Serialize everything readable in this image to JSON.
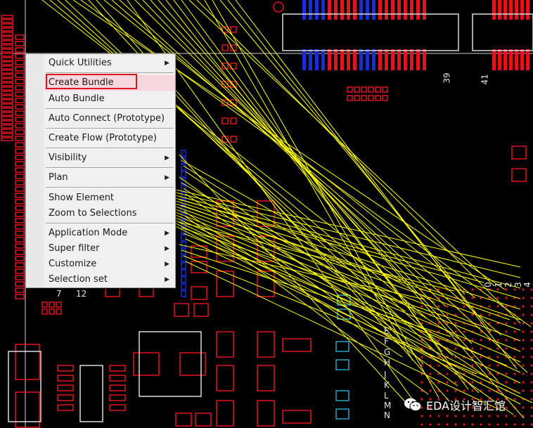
{
  "canvas": {
    "background": "#000000",
    "trace_color": "#ffff00",
    "pad_color": "#e0141e",
    "blue_pad_color": "#1a2bd8",
    "teal_color": "#29a3c8",
    "labels": {
      "num_7": "7",
      "num_12": "12",
      "num_39": "39",
      "num_41": "41",
      "letters": [
        "E",
        "F",
        "G",
        "H",
        "J",
        "K",
        "L",
        "M",
        "N"
      ],
      "right_digits": [
        "0",
        "1",
        "2",
        "3",
        "4"
      ]
    }
  },
  "context_menu": {
    "items": [
      {
        "label": "Quick Utilities",
        "submenu": true
      },
      {
        "label": "Create Bundle",
        "submenu": false,
        "highlighted": true
      },
      {
        "label": "Auto Bundle",
        "submenu": false
      },
      {
        "label": "Auto Connect (Prototype)",
        "submenu": false
      },
      {
        "label": "Create Flow (Prototype)",
        "submenu": false
      },
      {
        "label": "Visibility",
        "submenu": true
      },
      {
        "label": "Plan",
        "submenu": true
      },
      {
        "label": "Show Element",
        "submenu": false
      },
      {
        "label": "Zoom to Selections",
        "submenu": false
      },
      {
        "label": "Application Mode",
        "submenu": true
      },
      {
        "label": "Super filter",
        "submenu": true
      },
      {
        "label": "Customize",
        "submenu": true
      },
      {
        "label": "Selection set",
        "submenu": true
      }
    ],
    "submenu_arrow_icon": "triangle-right-icon",
    "highlight_color": "#e0141e"
  },
  "watermark": {
    "icon": "wechat-icon",
    "text": "EDA设计智汇馆"
  }
}
